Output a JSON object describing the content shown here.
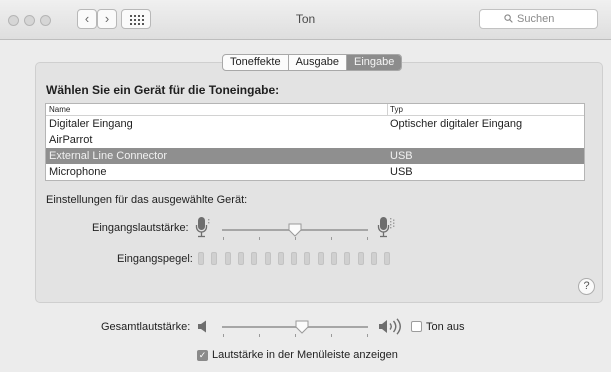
{
  "window": {
    "title": "Ton"
  },
  "toolbar": {
    "back_icon": "chevron-left-icon",
    "forward_icon": "chevron-right-icon",
    "show_all_icon": "grid-icon",
    "search_placeholder": "Suchen"
  },
  "tabs": [
    {
      "label": "Toneffekte",
      "selected": false
    },
    {
      "label": "Ausgabe",
      "selected": false
    },
    {
      "label": "Eingabe",
      "selected": true
    }
  ],
  "input": {
    "heading": "Wählen Sie ein Gerät für die Toneingabe:",
    "columns": {
      "name": "Name",
      "type": "Typ"
    },
    "devices": [
      {
        "name": "Digitaler Eingang",
        "type": "Optischer digitaler Eingang",
        "selected": false
      },
      {
        "name": "AirParrot",
        "type": "",
        "selected": false
      },
      {
        "name": "External Line Connector",
        "type": "USB",
        "selected": true
      },
      {
        "name": "Microphone",
        "type": "USB",
        "selected": false
      }
    ],
    "settings_label": "Einstellungen für das ausgewählte Gerät:",
    "volume_label": "Eingangslautstärke:",
    "volume_level": 0.5,
    "level_label": "Eingangspegel:",
    "level_bars": 15,
    "level_active": 0
  },
  "help": {
    "label": "?"
  },
  "output": {
    "volume_label": "Gesamtlautstärke:",
    "volume_level": 0.55,
    "mute_label": "Ton aus",
    "mute_checked": false,
    "menubar_label": "Lautstärke in der Menüleiste anzeigen",
    "menubar_checked": true
  },
  "colors": {
    "selection": "#8f8f8f",
    "background": "#ececec"
  }
}
